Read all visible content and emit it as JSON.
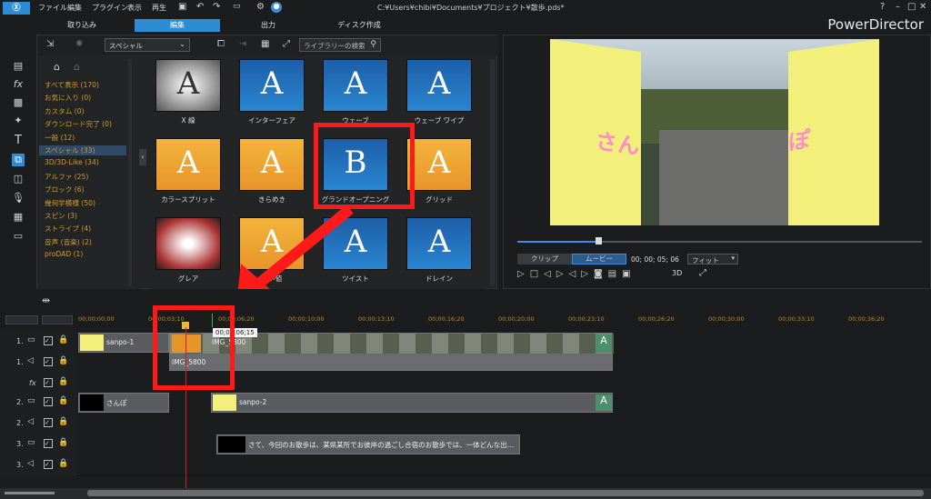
{
  "menu": {
    "items": [
      "ファイル",
      "編集",
      "プラグイン",
      "表示",
      "再生"
    ],
    "path": "C:¥Users¥chibi¥Documents¥プロジェクト¥散歩.pds*",
    "help": "?"
  },
  "modes": {
    "capture": "取り込み",
    "edit": "編集",
    "output": "出力",
    "disc": "ディスク作成"
  },
  "brand": "PowerDirector",
  "library": {
    "dropdown": "スペシャル",
    "search_placeholder": "ライブラリーの検索",
    "categories": [
      "すべて表示 (170)",
      "お気に入り (0)",
      "カスタム (0)",
      "ダウンロード完了 (0)",
      "一般 (12)",
      "スペシャル (33)",
      "3D/3D-Like (34)",
      "アルファ (25)",
      "ブロック (6)",
      "幾何学模様 (50)",
      "スピン (3)",
      "ストライプ (4)",
      "音声 (音楽) (2)",
      "proDAD (1)"
    ],
    "selected_index": 5,
    "thumbs": [
      "X 線",
      "インターフェア",
      "ウェーブ",
      "ウェーブ ワイプ",
      "カラースプリット",
      "きらめき",
      "グランドオープニング",
      "グリッド",
      "グレア",
      "きい値",
      "ツイスト",
      "ドレイン"
    ],
    "glyph_a": "A",
    "glyph_b": "B"
  },
  "preview": {
    "clip_tab": "クリップ",
    "movie_tab": "ムービー",
    "timecode": "00; 00; 05; 06",
    "fit": "フィット",
    "mode_3d": "3D",
    "sign_left": "さん",
    "sign_right": "ぽ"
  },
  "ruler": {
    "ticks": [
      "00;00;00;00",
      "00;00;03;10",
      "00;00;06;20",
      "00;00;10;00",
      "00;00;13;10",
      "00;00;16;20",
      "00;00;20;00",
      "00;00;23;10",
      "00;00;26;20",
      "00;00;30;00",
      "00;00;33;10",
      "00;00;36;20"
    ],
    "tooltip": "00;00;06;15"
  },
  "tracks": [
    {
      "num": "1.",
      "type": "video"
    },
    {
      "num": "1.",
      "type": "audio"
    },
    {
      "num": "fx",
      "type": "fx"
    },
    {
      "num": "2.",
      "type": "video"
    },
    {
      "num": "2.",
      "type": "audio"
    },
    {
      "num": "3.",
      "type": "video"
    },
    {
      "num": "3.",
      "type": "audio"
    }
  ],
  "clips": {
    "sanpo1": "sanpo-1",
    "img1": "IMG_5800",
    "img2": "IMG_5800",
    "sanpo_title": "さんぽ",
    "sanpo2": "sanpo-2",
    "caption": "さて、今回のお散歩は、某県某所でお彼岸の過ごし合宿のお散歩では、一体どんな出会いが"
  },
  "colors": {
    "accent": "#2d8cd6",
    "highlight": "#ff1a1a",
    "category": "#d49a2d"
  }
}
